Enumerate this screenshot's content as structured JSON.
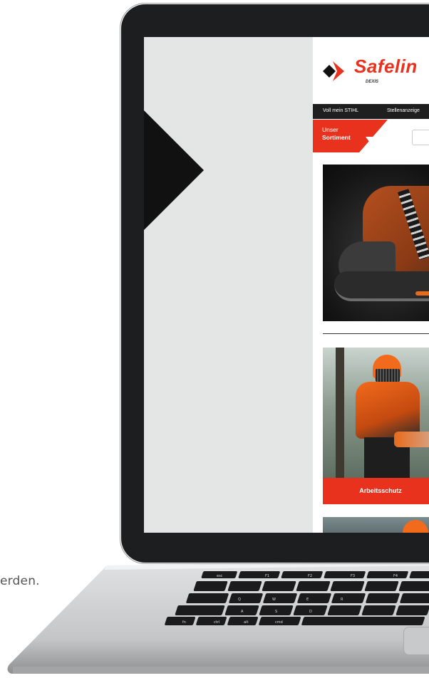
{
  "page": {
    "trailing_text": "erden."
  },
  "website": {
    "logo": {
      "brand": "Safelin",
      "sub": "DEXIS",
      "accent_color": "#e8321e"
    },
    "topnav": [
      {
        "label": "Voll mein STIHL"
      },
      {
        "label": "Stellenanzeige"
      }
    ],
    "sortiment": {
      "line1": "Unser",
      "line2": "Sortiment",
      "caret_icon": "caret-down-icon"
    },
    "search": {
      "placeholder": ""
    },
    "products": [
      {
        "image": "safety-boot-image",
        "label": ""
      },
      {
        "image": "chainsaw-worker-image",
        "label": "Arbeitsschutz"
      },
      {
        "image": "forestry-helmet-image",
        "label": ""
      }
    ]
  },
  "keyboard": {
    "labels": [
      "esc",
      "F1",
      "F2",
      "F3",
      "F4",
      "fn",
      "ctrl",
      "alt",
      "cmd",
      "Q",
      "W",
      "E",
      "R",
      "A",
      "S",
      "D",
      "Z",
      "X",
      "C"
    ]
  },
  "colors": {
    "brand_red": "#e8321e",
    "laptop_bezel": "#1d1e20",
    "laptop_body": "#b8b9bb",
    "screen_bg": "#e4e6e6"
  }
}
